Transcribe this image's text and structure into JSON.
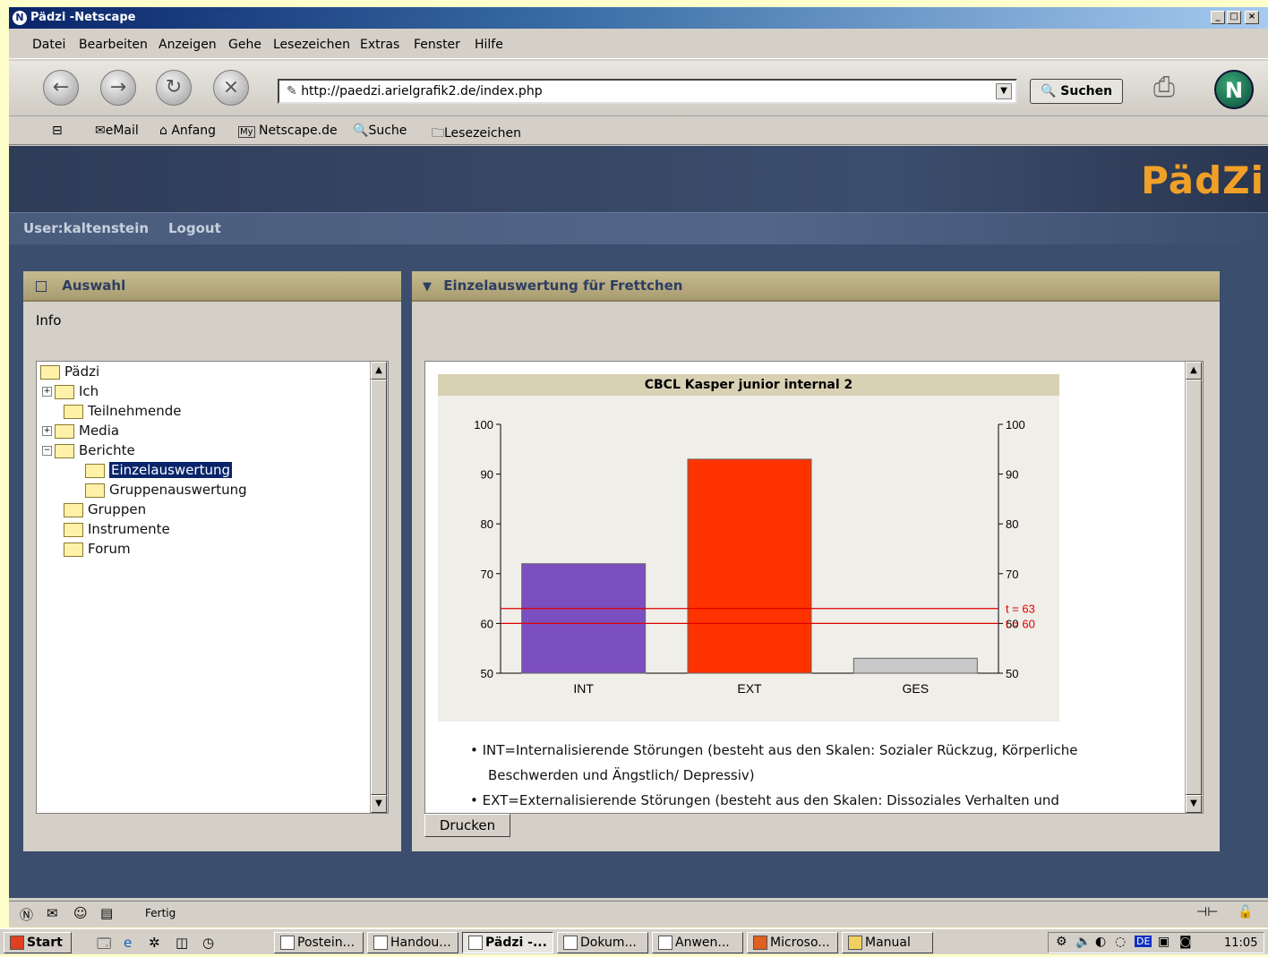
{
  "window": {
    "title": "Pädzi -Netscape"
  },
  "menu": [
    "Datei",
    "Bearbeiten",
    "Anzeigen",
    "Gehe",
    "Lesezeichen",
    "Extras",
    "Fenster",
    "Hilfe"
  ],
  "nav": {
    "url": "http://paedzi.arielgrafik2.de/index.php",
    "search_label": "Suchen"
  },
  "toolbar": {
    "email": "eMail",
    "home": "Anfang",
    "netscape": "Netscape.de",
    "search": "Suche",
    "bookmarks": "Lesezeichen"
  },
  "site": {
    "logo": "PädZi",
    "user": "User:kaltenstein",
    "logout": "Logout"
  },
  "left_panel": {
    "title": "Auswahl",
    "info": "Info",
    "tree": [
      {
        "label": "Pädzi"
      },
      {
        "label": "Ich"
      },
      {
        "label": "Teilnehmende"
      },
      {
        "label": "Media"
      },
      {
        "label": "Berichte"
      },
      {
        "label": "Einzelauswertung"
      },
      {
        "label": "Gruppenauswertung"
      },
      {
        "label": "Gruppen"
      },
      {
        "label": "Instrumente"
      },
      {
        "label": "Forum"
      }
    ]
  },
  "right_panel": {
    "title": "Einzelauswertung für Frettchen",
    "bullets": [
      "INT=Internalisierende Störungen (besteht aus den Skalen: Sozialer Rückzug, Körperliche",
      "Beschwerden und Ängstlich/ Depressiv)",
      "EXT=Externalisierende Störungen (besteht aus den Skalen: Dissoziales Verhalten und"
    ],
    "print_button": "Drucken"
  },
  "chart_data": {
    "type": "bar",
    "title": "CBCL Kasper junior internal 2",
    "categories": [
      "INT",
      "EXT",
      "GES"
    ],
    "values": [
      72,
      93,
      53
    ],
    "colors": [
      "#7B4FBF",
      "#FF3300",
      "#C8C8C8"
    ],
    "ylim": [
      50,
      100
    ],
    "yticks": [
      50,
      60,
      70,
      80,
      90,
      100
    ],
    "reference_lines": [
      {
        "label": "t = 63",
        "value": 63
      },
      {
        "label": "t = 60",
        "value": 60
      }
    ],
    "reference_color": "#DD0000"
  },
  "status": {
    "text": "Fertig"
  },
  "taskbar": {
    "start": "Start",
    "tasks": [
      "Postein...",
      "Handou...",
      "Pädzi -...",
      "Dokum...",
      "Anwen...",
      "Microso...",
      "Manual"
    ],
    "clock": "11:05",
    "lang": "DE"
  }
}
